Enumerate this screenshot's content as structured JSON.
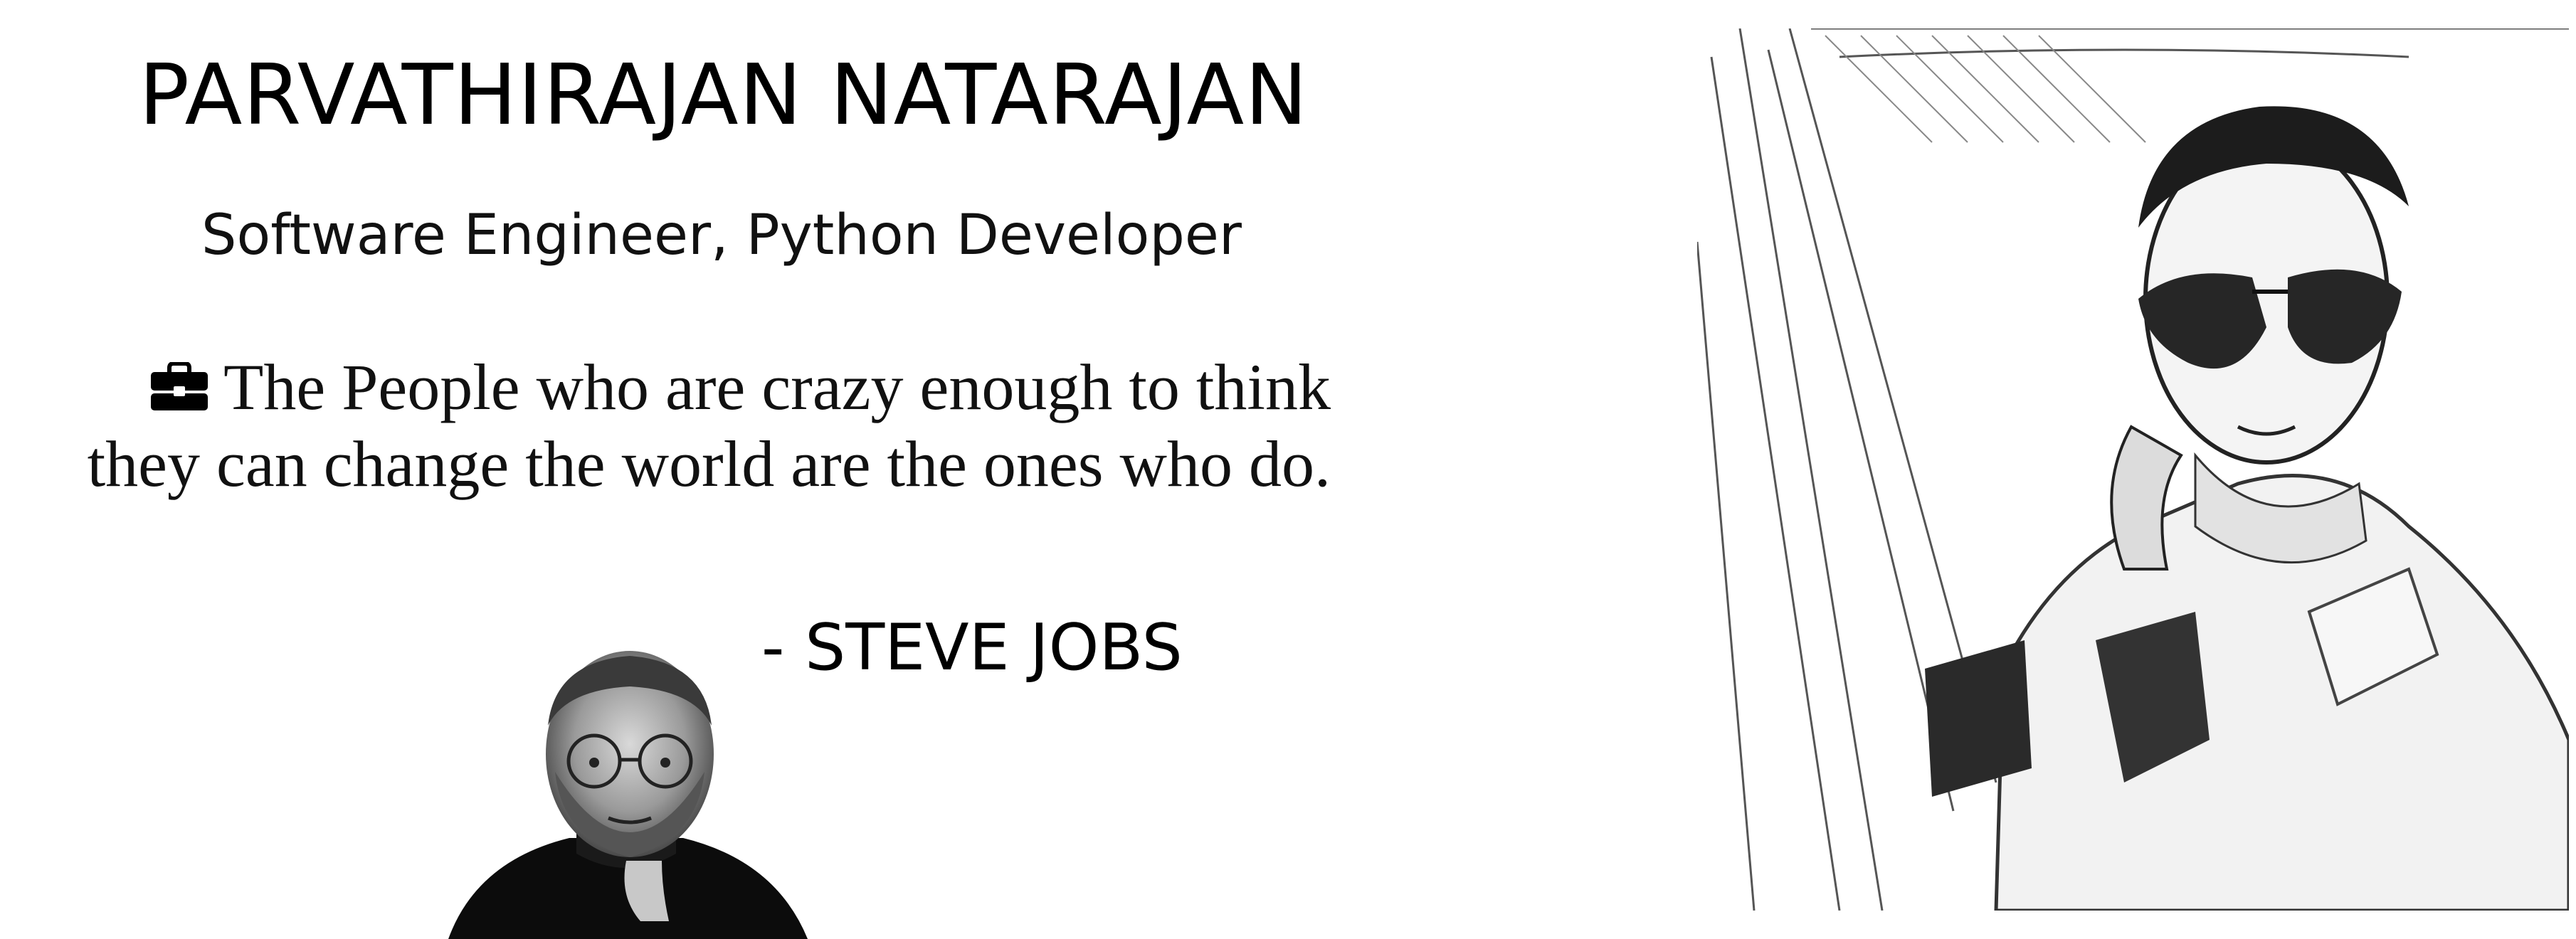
{
  "header": {
    "name": "PARVATHIRAJAN NATARAJAN",
    "role": "Software Engineer, Python Developer"
  },
  "quote": {
    "icon": "briefcase-icon",
    "text": "The People who are crazy enough to think they can change the world are the ones who do.",
    "author": "- STEVE JOBS"
  },
  "images": {
    "author_photo": "steve-jobs-portrait",
    "profile_photo": "pencil-sketch-self-portrait"
  }
}
